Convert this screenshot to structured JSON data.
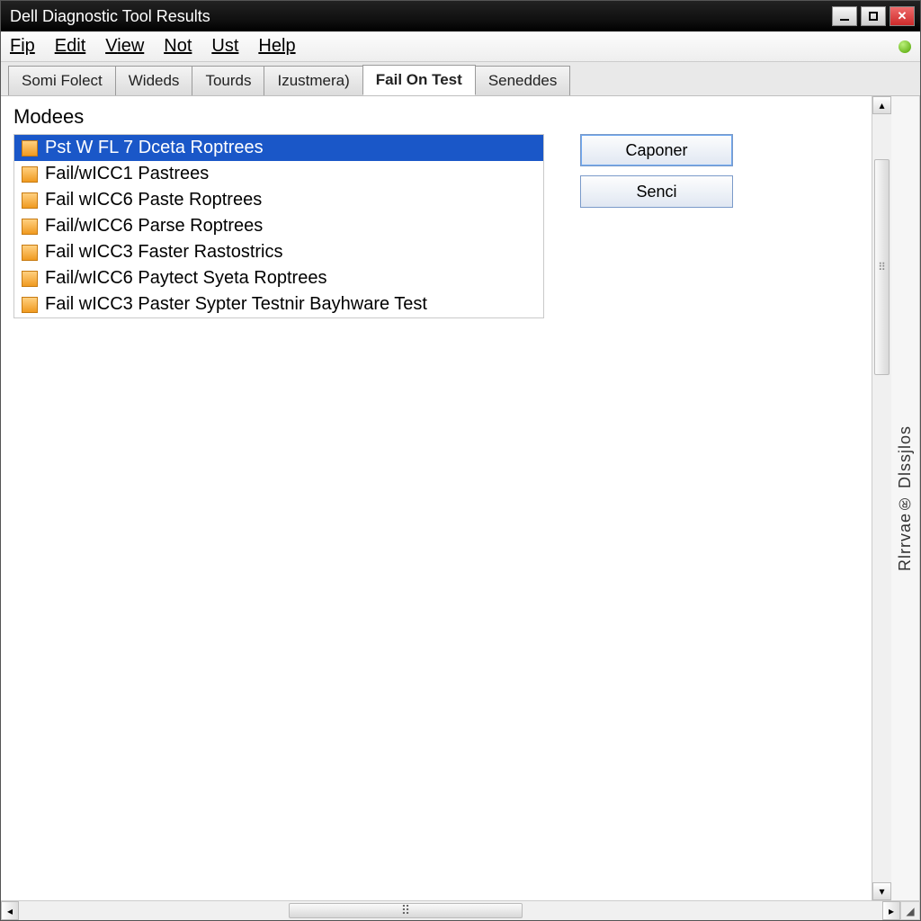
{
  "window": {
    "title": "Dell Diagnostic Tool  Results",
    "controls": {
      "minimize": "minimize",
      "maximize": "maximize",
      "close": "close"
    }
  },
  "menu": {
    "items": [
      {
        "label": "Fip",
        "underline_index": 0
      },
      {
        "label": "Edit",
        "underline_index": 0
      },
      {
        "label": "View",
        "underline_index": 0
      },
      {
        "label": "Not",
        "underline_index": 0
      },
      {
        "label": "Ust",
        "underline_index": 0
      },
      {
        "label": "Help",
        "underline_index": 0
      }
    ],
    "status_indicator": "green"
  },
  "tabs": {
    "items": [
      {
        "label": "Somi Folect"
      },
      {
        "label": "Wideds"
      },
      {
        "label": "Tourds"
      },
      {
        "label": "Izustmera)"
      },
      {
        "label": "Fail On Test"
      },
      {
        "label": "Seneddes"
      }
    ],
    "active_index": 4
  },
  "section": {
    "title": "Modees"
  },
  "list": {
    "selected_index": 0,
    "items": [
      "Pst W FL 7 Dceta Roptrees",
      "Fail/wICC1 Pastrees",
      "Fail wICC6 Paste Roptrees",
      "Fail/wICC6 Parse Roptrees",
      "Fail wICC3 Faster Rastostrics",
      "Fail/wICC6 Paytect Syeta Roptrees",
      "Fail wICC3 Paster Sypter Testnir Bayhware Test"
    ]
  },
  "buttons": {
    "primary": "Caponer",
    "secondary": "Senci"
  },
  "side_panel_label": "Rlrrvae® Dlssjlos"
}
